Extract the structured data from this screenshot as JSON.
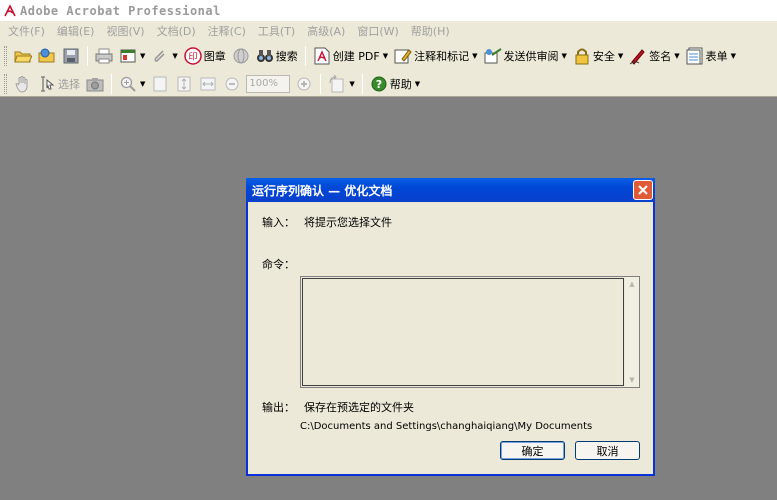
{
  "window": {
    "title": "Adobe Acrobat Professional",
    "icon": "acrobat-logo-icon"
  },
  "menu": [
    {
      "label": "文件(F)"
    },
    {
      "label": "编辑(E)"
    },
    {
      "label": "视图(V)"
    },
    {
      "label": "文档(D)"
    },
    {
      "label": "注释(C)"
    },
    {
      "label": "工具(T)"
    },
    {
      "label": "高级(A)"
    },
    {
      "label": "窗口(W)"
    },
    {
      "label": "帮助(H)"
    }
  ],
  "toolbar1": {
    "stamp_label": "图章",
    "search_label": "搜索",
    "create_pdf_label": "创建 PDF",
    "comment_label": "注释和标记",
    "review_label": "发送供审阅",
    "security_label": "安全",
    "sign_label": "签名",
    "forms_label": "表单"
  },
  "toolbar2": {
    "select_label": "选择",
    "zoom_value": "100%",
    "help_label": "帮助"
  },
  "dialog": {
    "title": "运行序列确认 — 优化文档",
    "input_label": "输入：",
    "input_value": "将提示您选择文件",
    "command_label": "命令：",
    "output_label": "输出：",
    "output_value": "保存在预选定的文件夹",
    "output_path": "C:\\Documents and Settings\\changhaiqiang\\My Documents",
    "ok_label": "确定",
    "cancel_label": "取消"
  }
}
